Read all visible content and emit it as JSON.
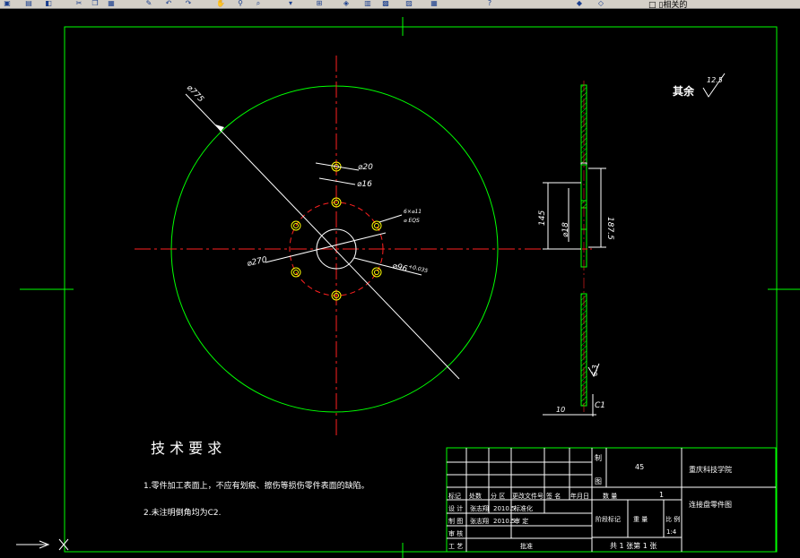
{
  "toolbar": {
    "icons": [
      "save-icon",
      "print-icon",
      "preview-icon",
      "cut-icon",
      "copy-icon",
      "paste-icon",
      "match-icon",
      "undo-icon",
      "redo-icon",
      "pan-icon",
      "zoom-icon",
      "zoom-window-icon",
      "zoom-prev-icon",
      "properties-icon",
      "design-center-icon",
      "tool-palette-icon",
      "sheet-set-icon",
      "markup-icon",
      "calc-icon",
      "help-icon",
      "layer-icon",
      "layer-state-icon"
    ],
    "layer_label": "□ ▯相关的"
  },
  "drawing": {
    "dims": {
      "d775": "⌀775",
      "d20": "⌀20",
      "d16": "⌀16",
      "d270": "⌀270",
      "d96": "⌀96",
      "d96_tol": "+0.035",
      "holes": "6×⌀11",
      "holes_sub": "⌀ EQS",
      "d145": "145",
      "d18": "⌀18",
      "d1875": "187.5",
      "d10": "10",
      "c1": "C1",
      "r63": "6.3",
      "r125": "12.5"
    },
    "roughness_note": "其余",
    "tech_title": "技 术 要 求",
    "tech_items": [
      "1.零件加工表面上，不应有划痕、擦伤等损伤零件表面的缺陷。",
      "2.未注明倒角均为C2."
    ]
  },
  "title_block": {
    "material": "45",
    "school": "重庆科技学院",
    "part_name": "连接盘零件图",
    "header": [
      "标记",
      "处数",
      "分 区",
      "更改文件号",
      "签 名",
      "年月日"
    ],
    "qty_label": "数  量",
    "qty_value": "1",
    "row_design": [
      "设 计",
      "张志翔",
      "2010.5",
      "标准化"
    ],
    "row_draw": [
      "制 图",
      "张志翔",
      "2010.5",
      "审 定"
    ],
    "row_check": "审 核",
    "row_process": "工 艺",
    "approve": "批准",
    "stage": "阶段标记",
    "weight": "重 量",
    "ratio": "比 例",
    "scale": "1:4",
    "sheet": "共 1 张第 1 张",
    "zhi": "制",
    "tu": "图"
  }
}
